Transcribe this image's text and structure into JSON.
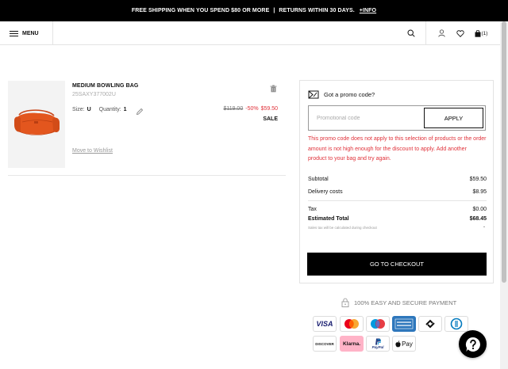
{
  "topbar": {
    "shipping_text": "FREE SHIPPING WHEN YOU SPEND $80 OR MORE",
    "separator": "|",
    "returns_text": "RETURNS WITHIN 30 DAYS.",
    "info_link": "+INFO"
  },
  "header": {
    "menu_label": "MENU",
    "bag_count": "(1)"
  },
  "product": {
    "name": "MEDIUM BOWLING BAG",
    "sku": "25SAXY377002U",
    "size_label": "Size:",
    "size_value": "U",
    "quantity_label": "Quantity:",
    "quantity_value": "1",
    "price_original": "$119.00",
    "price_discount": "-50%",
    "price_final": "$59.50",
    "sale_badge": "SALE",
    "wishlist_link": "Move to Wishlist"
  },
  "summary": {
    "promo_title": "Got a promo code?",
    "promo_placeholder": "Promotional code",
    "apply_label": "APPLY",
    "promo_error": "This promo code does not apply to this selection of products or the order amount is not high enough for the discount to apply. Add another product to your bag and try again.",
    "subtotal_label": "Subtotal",
    "subtotal_value": "$59.50",
    "delivery_label": "Delivery costs",
    "delivery_value": "$8.95",
    "tax_label": "Tax",
    "tax_value": "$0.00",
    "total_label": "Estimated Total",
    "total_value": "$68.45",
    "tax_note": "Sales tax will be calculated during checkout",
    "tax_note_dash": "-",
    "checkout_label": "GO TO CHECKOUT"
  },
  "payment": {
    "secure_text": "100% EASY AND SECURE PAYMENT",
    "methods": [
      "visa-icon",
      "mastercard-icon",
      "maestro-icon",
      "amex-icon",
      "sequra-icon",
      "diners-icon",
      "discover-icon",
      "klarna-icon",
      "paypal-icon",
      "apple-pay-icon"
    ],
    "visa": "VISA",
    "discover": "DISCOVER",
    "klarna": "Klarna.",
    "paypal": "PayPal",
    "applepay": "Pay"
  },
  "colors": {
    "error": "#e0323a",
    "black": "#000000",
    "product_orange": "#e3561e"
  }
}
